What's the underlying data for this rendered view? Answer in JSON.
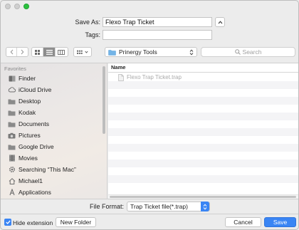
{
  "save_as": {
    "label": "Save As:",
    "value": "Flexo Trap Ticket"
  },
  "tags": {
    "label": "Tags:",
    "value": ""
  },
  "toolbar": {
    "location": "Prinergy Tools",
    "search_placeholder": "Search"
  },
  "sidebar": {
    "heading": "Favorites",
    "items": [
      {
        "label": "Finder",
        "icon": "finder-icon"
      },
      {
        "label": "iCloud Drive",
        "icon": "cloud-icon"
      },
      {
        "label": "Desktop",
        "icon": "folder-icon"
      },
      {
        "label": "Kodak",
        "icon": "folder-icon"
      },
      {
        "label": "Documents",
        "icon": "folder-icon"
      },
      {
        "label": "Pictures",
        "icon": "camera-icon"
      },
      {
        "label": "Google Drive",
        "icon": "folder-icon"
      },
      {
        "label": "Movies",
        "icon": "film-icon"
      },
      {
        "label": "Searching “This Mac”",
        "icon": "gear-icon"
      },
      {
        "label": "Michael1",
        "icon": "home-icon"
      },
      {
        "label": "Applications",
        "icon": "applications-icon"
      }
    ]
  },
  "file_list": {
    "column_header": "Name",
    "files": [
      {
        "name": "Flexo Trap Ticket.trap",
        "icon": "document-icon"
      }
    ]
  },
  "file_format": {
    "label": "File Format:",
    "value": "Trap Ticket file(*.trap)"
  },
  "bottom": {
    "hide_extension_label": "Hide extension",
    "new_folder_label": "New Folder",
    "cancel_label": "Cancel",
    "save_label": "Save"
  },
  "colors": {
    "accent": "#3a85f4",
    "window_bg": "#ececec"
  }
}
